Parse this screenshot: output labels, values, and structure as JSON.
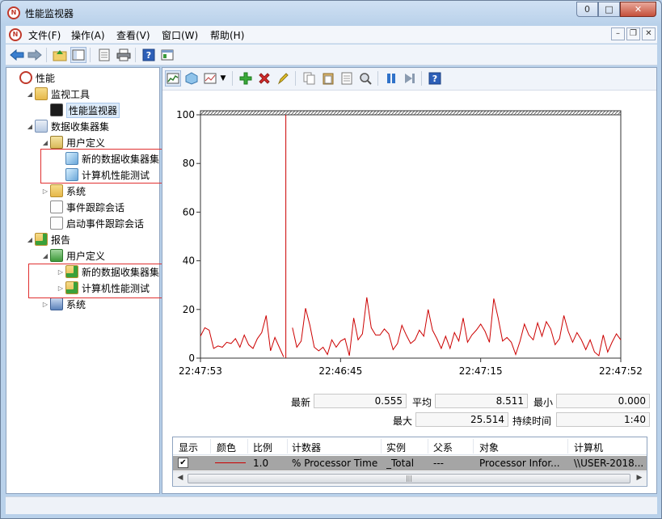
{
  "window": {
    "title": "性能监视器",
    "buttons": {
      "minimize": "0",
      "maximize": "□",
      "close": "✕"
    }
  },
  "menubar": {
    "items": [
      "文件(F)",
      "操作(A)",
      "查看(V)",
      "窗口(W)",
      "帮助(H)"
    ],
    "mdi": {
      "minimize": "–",
      "restore": "❐",
      "close": "✕"
    }
  },
  "toolbar": {
    "icons": [
      "back-icon",
      "forward-icon",
      "up-folder-icon",
      "show-hide-tree-icon",
      "properties-icon",
      "print-icon",
      "help-icon",
      "console-icon"
    ]
  },
  "tree": {
    "items": [
      {
        "label": "性能",
        "icon": "perf",
        "indent": 0,
        "arrow": ""
      },
      {
        "label": "监视工具",
        "icon": "folder",
        "indent": 1,
        "arrow": "◢"
      },
      {
        "label": "性能监视器",
        "icon": "monitor",
        "indent": 2,
        "arrow": "",
        "selected": true
      },
      {
        "label": "数据收集器集",
        "icon": "dcs",
        "indent": 1,
        "arrow": "◢"
      },
      {
        "label": "用户定义",
        "icon": "user",
        "indent": 2,
        "arrow": "◢"
      },
      {
        "label": "新的数据收集器集",
        "icon": "cube",
        "indent": 3,
        "arrow": ""
      },
      {
        "label": "计算机性能测试",
        "icon": "cube",
        "indent": 3,
        "arrow": ""
      },
      {
        "label": "系统",
        "icon": "folder",
        "indent": 2,
        "arrow": "▷"
      },
      {
        "label": "事件跟踪会话",
        "icon": "doc",
        "indent": 2,
        "arrow": ""
      },
      {
        "label": "启动事件跟踪会话",
        "icon": "doc",
        "indent": 2,
        "arrow": ""
      },
      {
        "label": "报告",
        "icon": "report",
        "indent": 1,
        "arrow": "◢"
      },
      {
        "label": "用户定义",
        "icon": "report-user",
        "indent": 2,
        "arrow": "◢"
      },
      {
        "label": "新的数据收集器集",
        "icon": "report",
        "indent": 3,
        "arrow": "▷"
      },
      {
        "label": "计算机性能测试",
        "icon": "report",
        "indent": 3,
        "arrow": "▷"
      },
      {
        "label": "系统",
        "icon": "sys",
        "indent": 2,
        "arrow": "▷"
      }
    ]
  },
  "graph_toolbar": {
    "icons": [
      "view-graph-icon",
      "freeze-display-icon",
      "change-graph-type-icon",
      "dropdown-arrow-icon",
      "add-counter-icon",
      "delete-counter-icon",
      "highlight-icon",
      "copy-properties-icon",
      "paste-counter-list-icon",
      "properties-icon",
      "zoom-icon",
      "pause-icon",
      "update-data-icon",
      "help-icon"
    ]
  },
  "chart_data": {
    "type": "line",
    "ylim": [
      0,
      100
    ],
    "yticks": [
      "100",
      "80",
      "60",
      "40",
      "20",
      "0"
    ],
    "xticks": [
      "22:47:53",
      "22:46:45",
      "22:47:15",
      "22:47:52"
    ],
    "series": [
      {
        "color": "#cc0000",
        "values": [
          9,
          12.5,
          11.5,
          4,
          5,
          4.5,
          6.5,
          6,
          8,
          4.5,
          9.5,
          5.5,
          4,
          8,
          10.5,
          17.5,
          3,
          8.5,
          4.5,
          0.5,
          null,
          12.5,
          4.5,
          7,
          20.5,
          13.5,
          4.5,
          3,
          4.5,
          1.5,
          7.5,
          4.5,
          7,
          8,
          1,
          16.5,
          7.5,
          10,
          25,
          12.5,
          9.5,
          9.5,
          12,
          10,
          3.5,
          6,
          13.5,
          9.5,
          6,
          7.5,
          11.5,
          9,
          20,
          11.5,
          8,
          4,
          9,
          4,
          10.5,
          7,
          16.5,
          6.5,
          9.5,
          11.5,
          14,
          11,
          6.5,
          24.5,
          16.5,
          7,
          8.5,
          6.5,
          1.5,
          7,
          14,
          9.5,
          7.5,
          14.5,
          9,
          15,
          12,
          5.5,
          8,
          17.5,
          11,
          6.5,
          10.5,
          7.5,
          3.5,
          7.5,
          2.5,
          1,
          9.5,
          2.5,
          6.5,
          10,
          7.5
        ]
      }
    ]
  },
  "stats": {
    "latest_label": "最新",
    "latest_value": "0.555",
    "average_label": "平均",
    "average_value": "8.511",
    "minimum_label": "最小",
    "minimum_value": "0.000",
    "maximum_label": "最大",
    "maximum_value": "25.514",
    "duration_label": "持续时间",
    "duration_value": "1:40"
  },
  "legend": {
    "headers": [
      "显示",
      "颜色",
      "比例",
      "计数器",
      "实例",
      "父系",
      "对象",
      "计算机"
    ],
    "row": {
      "show": "✔",
      "color": "#cc0000",
      "scale": "1.0",
      "counter": "% Processor Time",
      "instance": "_Total",
      "parent": "---",
      "object": "Processor Infor...",
      "computer": "\\\\USER-2018..."
    },
    "scroll_grip": "|||"
  }
}
